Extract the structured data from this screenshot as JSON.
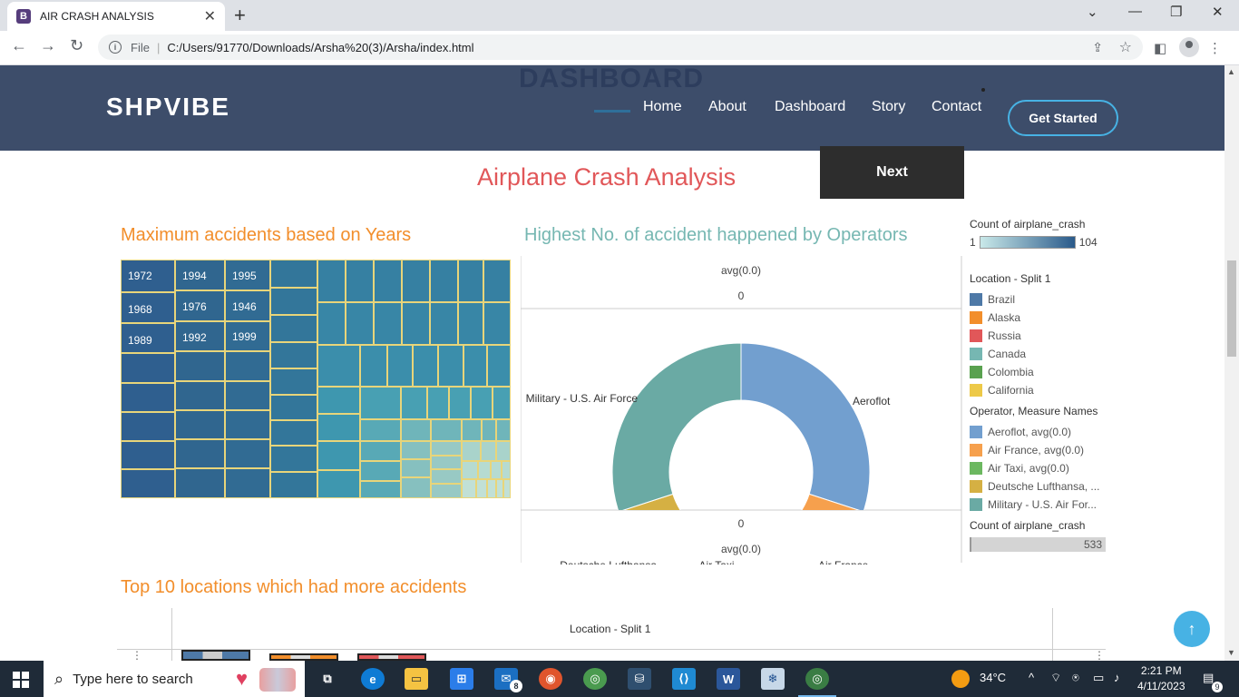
{
  "browser": {
    "tab_title": "AIR CRASH ANALYSIS",
    "tab_favicon": "B",
    "url_scheme": "File",
    "url_path": "C:/Users/91770/Downloads/Arsha%20(3)/Arsha/index.html"
  },
  "header": {
    "ghost_text": "DASHBOARD",
    "logo": "SHPVIBE",
    "nav": [
      "Home",
      "About",
      "Dashboard",
      "Story",
      "Contact"
    ],
    "cta": "Get Started"
  },
  "dashboard": {
    "title": "Airplane Crash Analysis",
    "next_label": "Next",
    "section_years": "Maximum accidents based on Years",
    "section_operators": "Highest No. of accident happened by Operators",
    "section_locations": "Top 10 locations which had more accidents",
    "location_axis_label": "Location - Split 1",
    "donut_labels": {
      "axis_top": "avg(0.0)",
      "zero_top": "0",
      "zero_bottom": "0",
      "axis_bottom": "avg(0.0)"
    }
  },
  "legend": {
    "count_title": "Count of airplane_crash",
    "count_min": "1",
    "count_max": "104",
    "location_title": "Location - Split 1",
    "locations": [
      {
        "label": "Brazil",
        "color": "#4e79a7"
      },
      {
        "label": "Alaska",
        "color": "#f28e2b"
      },
      {
        "label": "Russia",
        "color": "#e15759"
      },
      {
        "label": "Canada",
        "color": "#76b7b2"
      },
      {
        "label": "Colombia",
        "color": "#59a14f"
      },
      {
        "label": "California",
        "color": "#edc948"
      }
    ],
    "operator_title": "Operator, Measure Names",
    "operators": [
      {
        "label": "Aeroflot, avg(0.0)",
        "color": "#729fcf"
      },
      {
        "label": "Air France, avg(0.0)",
        "color": "#f6a04d"
      },
      {
        "label": "Air Taxi, avg(0.0)",
        "color": "#6cb860"
      },
      {
        "label": "Deutsche Lufthansa, ...",
        "color": "#d5b043"
      },
      {
        "label": "Military - U.S. Air For...",
        "color": "#6aaaa4"
      }
    ],
    "count_title_2": "Count of airplane_crash",
    "count_total": "533"
  },
  "chart_data": [
    {
      "type": "treemap",
      "title": "Maximum accidents based on Years",
      "labeled_categories": [
        "1972",
        "1994",
        "1995",
        "1968",
        "1976",
        "1946",
        "1989",
        "1992",
        "1999"
      ]
    },
    {
      "type": "pie",
      "title": "Highest No. of accident happened by Operators",
      "categories": [
        "Aeroflot",
        "Air France",
        "Air Taxi",
        "Deutsche Lufthansa",
        "Military - U.S. Air Force"
      ],
      "values": [
        30,
        14,
        9,
        17,
        30
      ],
      "colors": [
        "#729fcf",
        "#f6a04d",
        "#6cb860",
        "#d5b043",
        "#6aaaa4"
      ]
    }
  ],
  "taskbar": {
    "search_placeholder": "Type here to search",
    "weather": "34°C",
    "time": "2:21 PM",
    "date": "4/11/2023",
    "notifications": "9",
    "mail_badge": "8"
  }
}
